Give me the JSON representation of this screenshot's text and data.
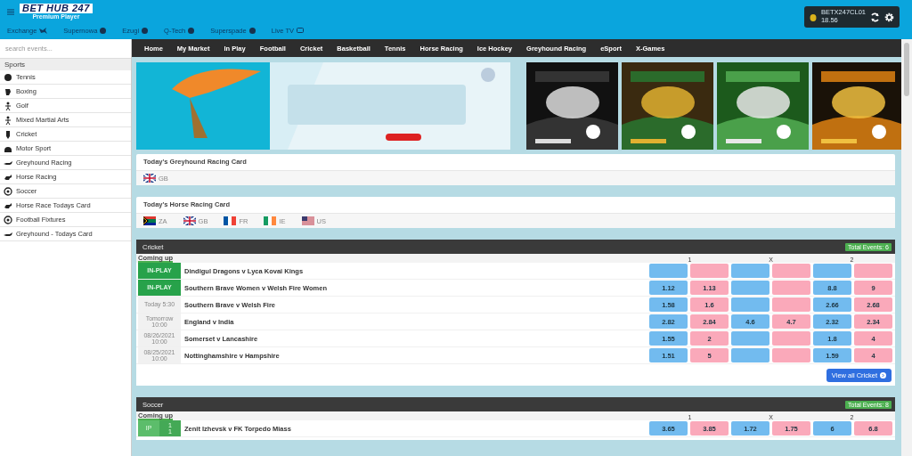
{
  "header": {
    "logo": "BET HUB 247",
    "logo_tagline": "Premium Player",
    "subnav": [
      {
        "label": "Exchange",
        "kind": "plane"
      },
      {
        "label": "Supernowa",
        "kind": "badge"
      },
      {
        "label": "Ezugi",
        "kind": "badge"
      },
      {
        "label": "Q-Tech",
        "kind": "badge"
      },
      {
        "label": "Superspade",
        "kind": "badge"
      },
      {
        "label": "Live TV",
        "kind": "tv"
      }
    ],
    "account": {
      "user": "BETX247CL01",
      "balance": "18.56"
    }
  },
  "nav": [
    {
      "label": "Home"
    },
    {
      "label": "My Market"
    },
    {
      "label": "In Play"
    },
    {
      "label": "Football"
    },
    {
      "label": "Cricket"
    },
    {
      "label": "Basketball"
    },
    {
      "label": "Tennis"
    },
    {
      "label": "Horse Racing"
    },
    {
      "label": "Ice Hockey"
    },
    {
      "label": "Greyhound Racing"
    },
    {
      "label": "eSport"
    },
    {
      "label": "X-Games"
    }
  ],
  "sidebar": {
    "search": {
      "placeholder": "search events..."
    },
    "heading": "Sports",
    "items": [
      {
        "label": "Tennis"
      },
      {
        "label": "Boxing"
      },
      {
        "label": "Golf"
      },
      {
        "label": "Mixed Martial Arts"
      },
      {
        "label": "Cricket"
      },
      {
        "label": "Motor Sport"
      },
      {
        "label": "Greyhound Racing"
      },
      {
        "label": "Horse Racing"
      },
      {
        "label": "Soccer"
      },
      {
        "label": "Horse Race Todays Card"
      },
      {
        "label": "Football Fixtures"
      },
      {
        "label": "Greyhound - Todays Card"
      }
    ]
  },
  "race_cards": [
    {
      "title": "Today's Greyhound Racing Card",
      "countries": [
        {
          "code": "GB"
        }
      ]
    },
    {
      "title": "Today's Horse Racing Card",
      "countries": [
        {
          "code": "ZA"
        },
        {
          "code": "GB"
        },
        {
          "code": "FR"
        },
        {
          "code": "IE"
        },
        {
          "code": "US"
        }
      ]
    }
  ],
  "sections": [
    {
      "title": "Cricket",
      "total": "Total Events: 6",
      "subtitle": "Coming up",
      "columns": [
        "1",
        "X",
        "2"
      ],
      "view_all": "View all Cricket",
      "events": [
        {
          "kind": "inplay",
          "status": "IN-PLAY",
          "name": "Dindigul Dragons v Lyca Kovai Kings",
          "odds": [
            {
              "kind": "back"
            },
            {
              "kind": "lay"
            },
            {
              "kind": "back"
            },
            {
              "kind": "lay"
            },
            {
              "kind": "back"
            },
            {
              "kind": "lay"
            }
          ]
        },
        {
          "kind": "inplay",
          "status": "IN-PLAY",
          "name": "Southern Brave Women v Welsh Fire Women",
          "odds": [
            {
              "kind": "back",
              "value": "1.12"
            },
            {
              "kind": "lay",
              "value": "1.13"
            },
            {
              "kind": "back"
            },
            {
              "kind": "lay"
            },
            {
              "kind": "back",
              "value": "8.8"
            },
            {
              "kind": "lay",
              "value": "9"
            }
          ]
        },
        {
          "kind": "time",
          "status": "Today 5:30",
          "name": "Southern Brave v Welsh Fire",
          "odds": [
            {
              "kind": "back",
              "value": "1.58"
            },
            {
              "kind": "lay",
              "value": "1.6"
            },
            {
              "kind": "back"
            },
            {
              "kind": "lay"
            },
            {
              "kind": "back",
              "value": "2.66"
            },
            {
              "kind": "lay",
              "value": "2.68"
            }
          ]
        },
        {
          "kind": "time",
          "status": "Tomorrow 10:00",
          "name": "England v India",
          "odds": [
            {
              "kind": "back",
              "value": "2.82"
            },
            {
              "kind": "lay",
              "value": "2.84"
            },
            {
              "kind": "back",
              "value": "4.6"
            },
            {
              "kind": "lay",
              "value": "4.7"
            },
            {
              "kind": "back",
              "value": "2.32"
            },
            {
              "kind": "lay",
              "value": "2.34"
            }
          ]
        },
        {
          "kind": "time",
          "status": "08/26/2021 10:00",
          "name": "Somerset v Lancashire",
          "odds": [
            {
              "kind": "back",
              "value": "1.55"
            },
            {
              "kind": "lay",
              "value": "2"
            },
            {
              "kind": "back"
            },
            {
              "kind": "lay"
            },
            {
              "kind": "back",
              "value": "1.8"
            },
            {
              "kind": "lay",
              "value": "4"
            }
          ]
        },
        {
          "kind": "time",
          "status": "08/25/2021 10:00",
          "name": "Nottinghamshire v Hampshire",
          "odds": [
            {
              "kind": "back",
              "value": "1.51"
            },
            {
              "kind": "lay",
              "value": "5"
            },
            {
              "kind": "back"
            },
            {
              "kind": "lay"
            },
            {
              "kind": "back",
              "value": "1.59"
            },
            {
              "kind": "lay",
              "value": "4"
            }
          ]
        }
      ]
    },
    {
      "title": "Soccer",
      "total": "Total Events: 8",
      "subtitle": "Coming up",
      "columns": [
        "1",
        "X",
        "2"
      ],
      "events": [
        {
          "kind": "score",
          "status": "IP",
          "score": [
            "1",
            "1"
          ],
          "name": "Zenit Izhevsk v FK Torpedo Miass",
          "odds": [
            {
              "kind": "back",
              "value": "3.65"
            },
            {
              "kind": "lay",
              "value": "3.85"
            },
            {
              "kind": "back",
              "value": "1.72"
            },
            {
              "kind": "lay",
              "value": "1.75"
            },
            {
              "kind": "back",
              "value": "6"
            },
            {
              "kind": "lay",
              "value": "6.8"
            }
          ]
        }
      ]
    }
  ]
}
